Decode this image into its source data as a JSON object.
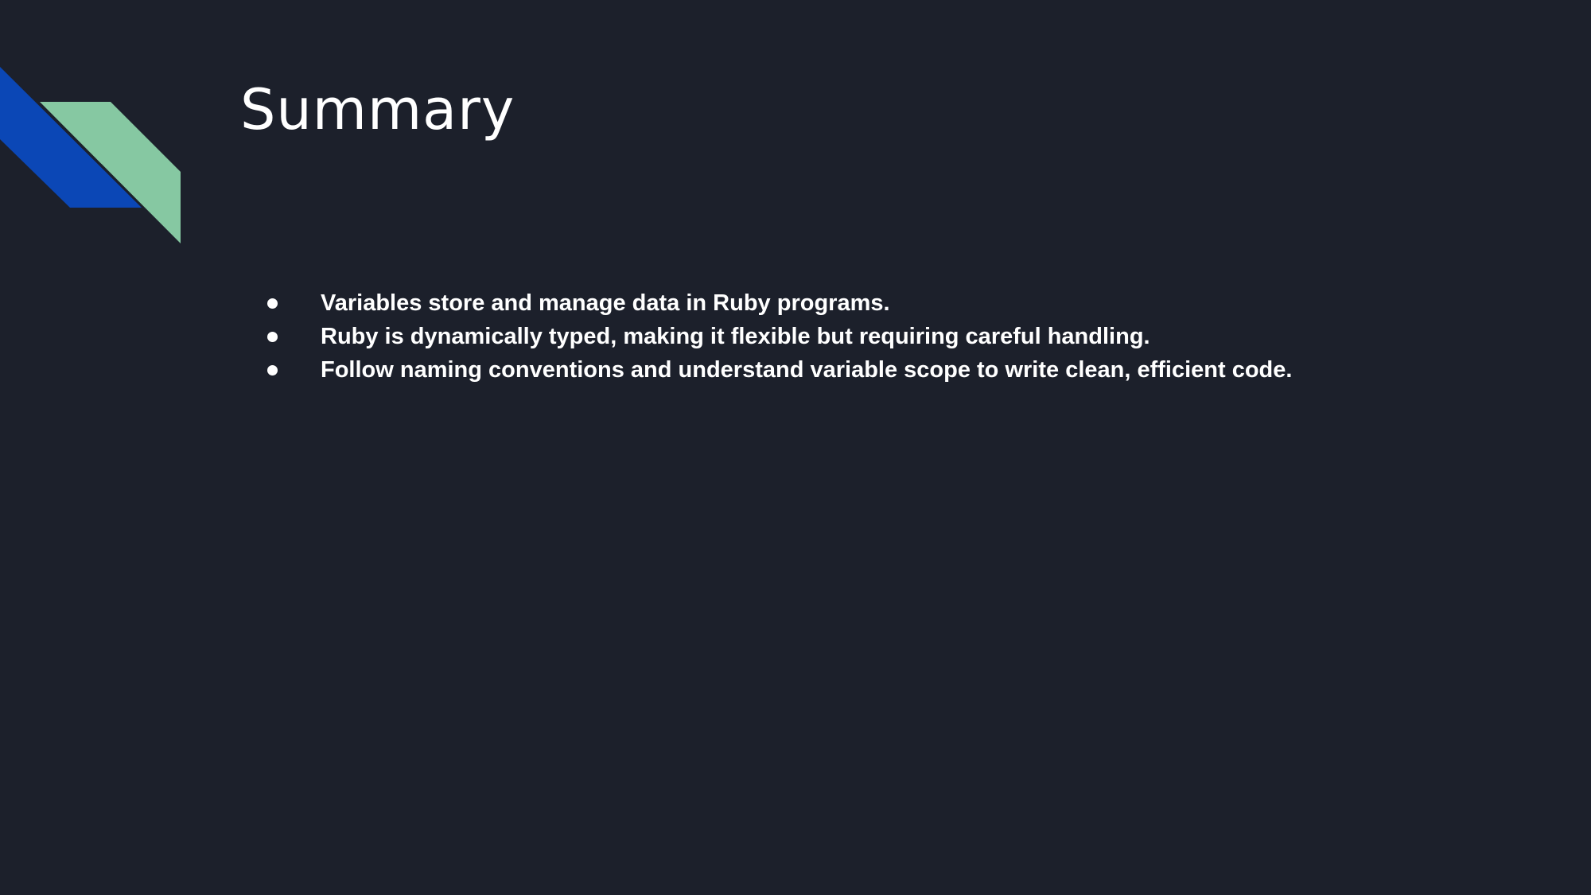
{
  "slide": {
    "title": "Summary",
    "bullets": [
      {
        "text": "Variables store and manage data in Ruby programs."
      },
      {
        "text": "Ruby is dynamically typed, making it flexible but requiring careful handling."
      },
      {
        "text": "Follow naming conventions and understand variable scope to write clean, efficient code."
      }
    ]
  },
  "colors": {
    "background": "#1c202b",
    "accent_blue": "#0b47b6",
    "accent_green": "#86c8a2",
    "text": "#ffffff"
  }
}
